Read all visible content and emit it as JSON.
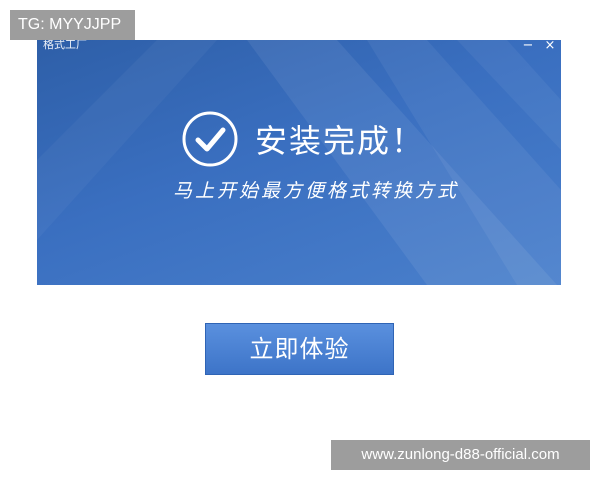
{
  "watermark": {
    "tag": "TG: MYYJJPP",
    "url": "www.zunlong-d88-official.com"
  },
  "window": {
    "title": "格式工厂",
    "minimize_label": "−",
    "close_label": "×",
    "success_title": "安装完成！",
    "subtitle": "马上开始最方便格式转换方式"
  },
  "button": {
    "label": "立即体验"
  },
  "colors": {
    "window_bg": "#3a6fc0",
    "button_bg": "#4a82d4",
    "text": "#ffffff",
    "watermark_bg": "#8c8c8c"
  },
  "icons": {
    "success": "check-circle-icon",
    "minimize": "minimize-icon",
    "close": "close-icon"
  }
}
